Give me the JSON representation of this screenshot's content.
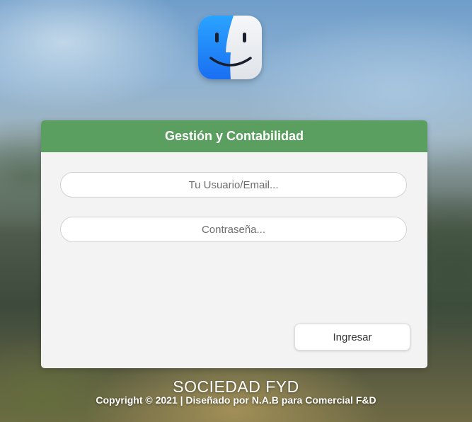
{
  "logo": {
    "icon": "finder-face-icon",
    "colors": {
      "left": "#1c8ef9",
      "right": "#eef1f4"
    }
  },
  "login": {
    "title": "Gestión y Contabilidad",
    "username_placeholder": "Tu Usuario/Email...",
    "username_value": "",
    "password_placeholder": "Contraseña...",
    "password_value": "",
    "submit_label": "Ingresar",
    "header_color": "#5a9e60"
  },
  "footer": {
    "company": "SOCIEDAD FYD",
    "copyright": "Copyright © 2021 | Diseñado por N.A.B para Comercial F&D"
  }
}
